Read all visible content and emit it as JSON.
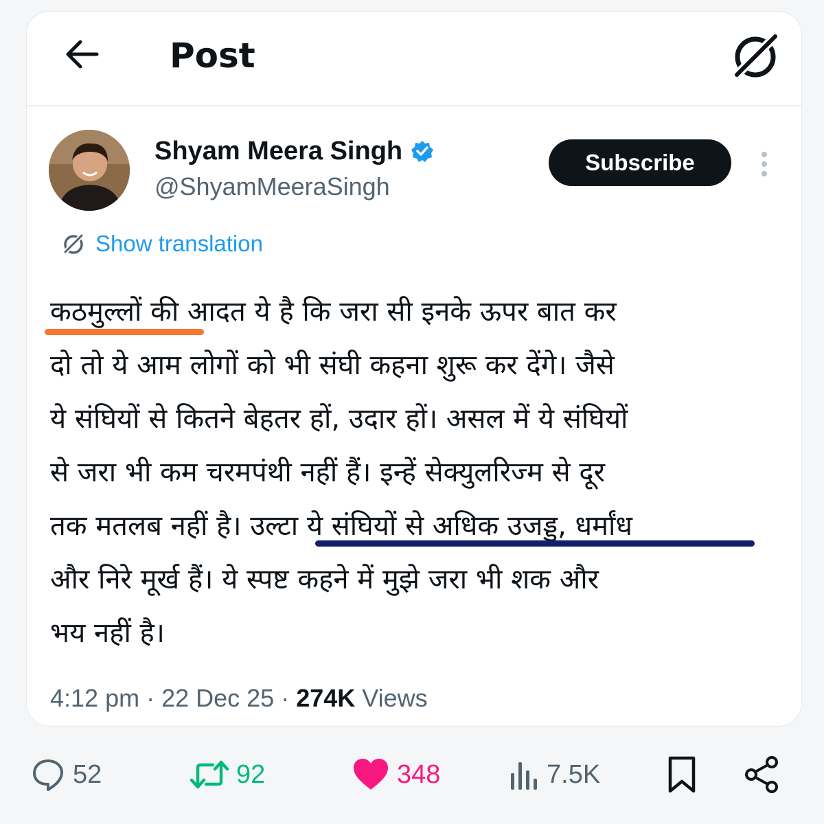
{
  "header": {
    "title": "Post"
  },
  "author": {
    "name": "Shyam Meera Singh",
    "handle": "@ShyamMeeraSingh",
    "verified": true
  },
  "subscribe_label": "Subscribe",
  "translation_label": "Show translation",
  "post": {
    "text": "कठमुल्लों की आदत ये है कि जरा सी इनके ऊपर बात कर\nदो तो ये आम लोगों को भी संघी कहना शुरू कर देंगे। जैसे\nये संघियों से कितने बेहतर हों, उदार हों। असल में ये संघियों\nसे जरा भी कम चरमपंथी नहीं हैं। इन्हें सेक्युलरिज्म से दूर\nतक मतलब नहीं है। उल्टा ये संघियों से अधिक उजड्ड, धर्मांध\nऔर निरे मूर्ख हैं। ये स्पष्ट कहने में मुझे जरा भी शक और\nभय नहीं है।"
  },
  "meta": {
    "time": "4:12 pm",
    "separator": " · ",
    "date": "22 Dec 25",
    "views_count": "274K",
    "views_label": " Views"
  },
  "actions": {
    "replies": "52",
    "reposts": "92",
    "likes": "348",
    "views": "7.5K"
  },
  "colors": {
    "accent": "#1d9bf0",
    "repost": "#00ba7c",
    "like": "#f91880",
    "highlight_orange": "#f4782f",
    "highlight_navy": "#10206a"
  }
}
